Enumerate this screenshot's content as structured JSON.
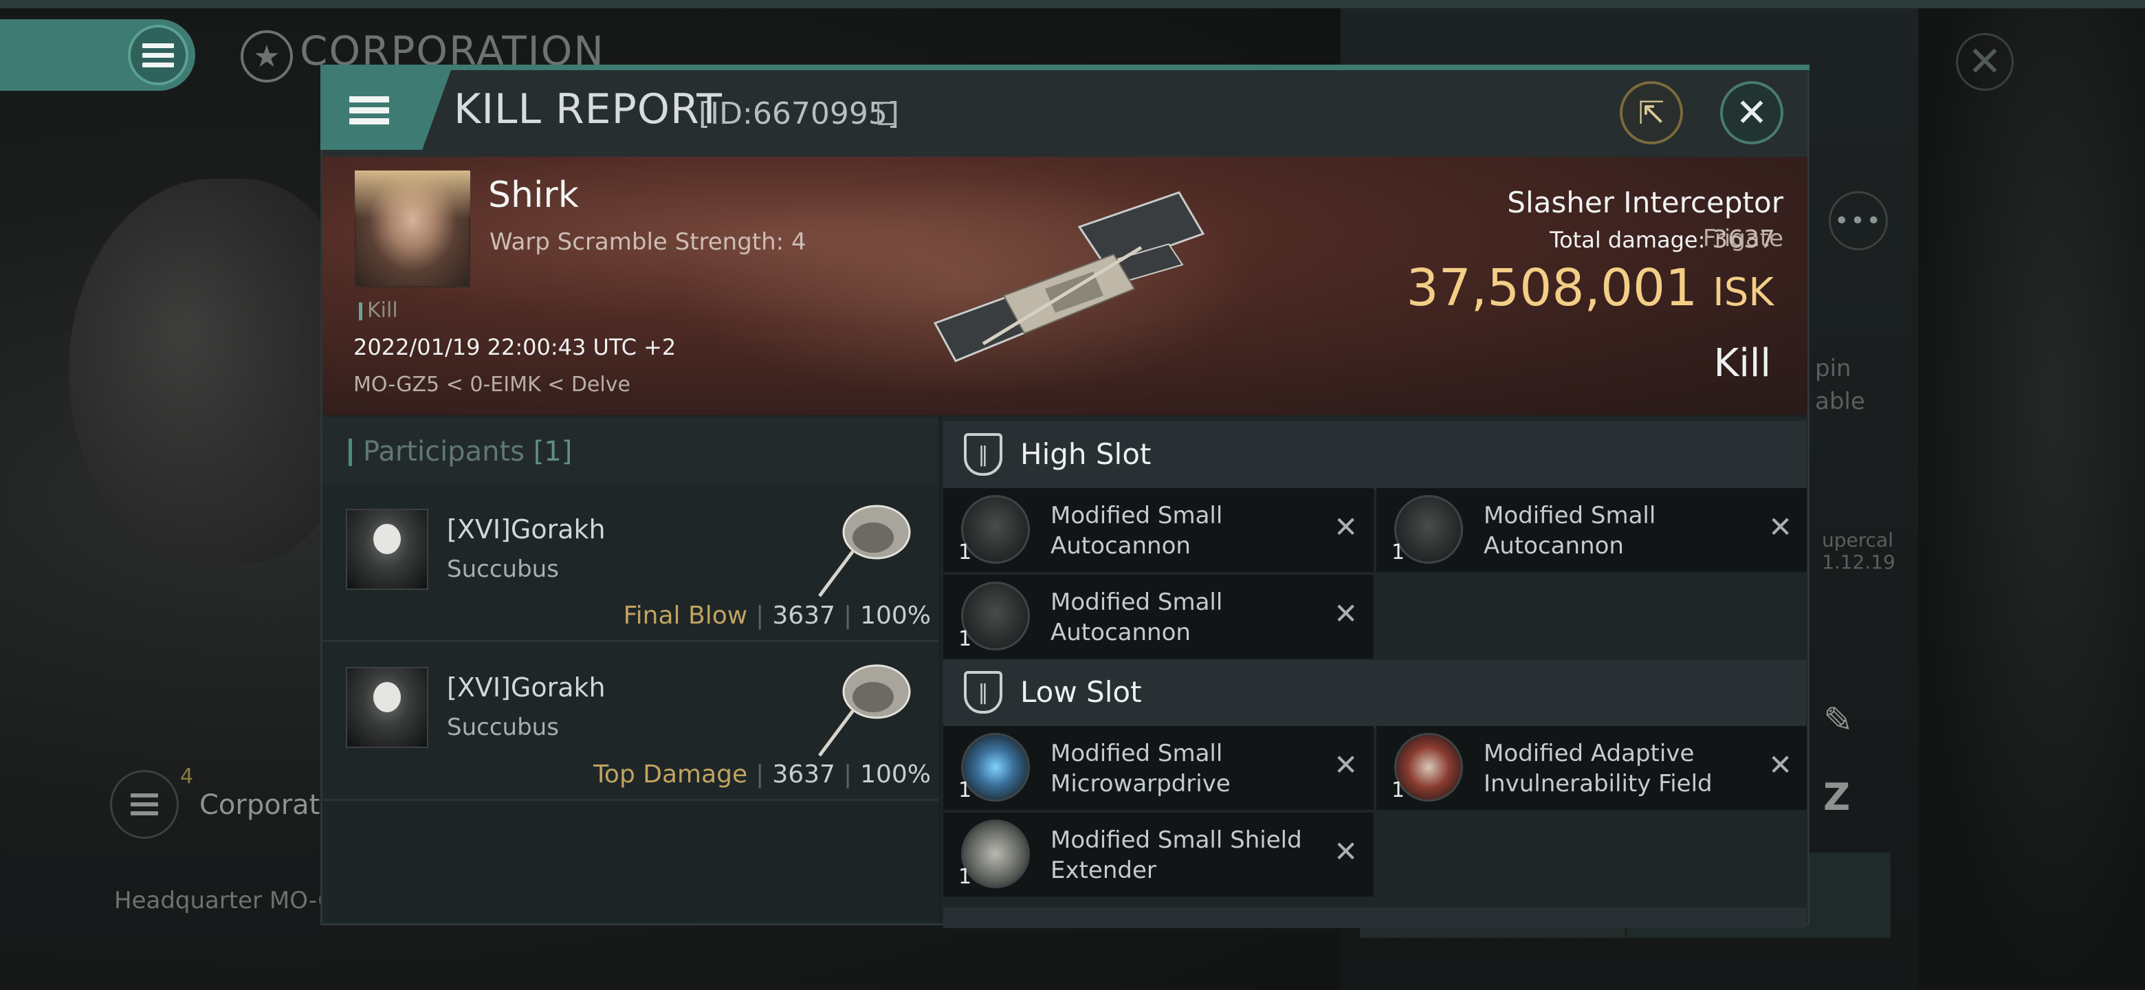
{
  "background": {
    "corp_title": "CORPORATION",
    "side_text_1": "pin",
    "side_text_2": "able",
    "side_text_3": "upercal",
    "side_text_4": "1.12.19",
    "corp_count": "4",
    "corp_label": "Corporati",
    "hq_label": "Headquarter MO-G"
  },
  "header": {
    "title": "KILL REPORT",
    "id": "[ID:6670995]"
  },
  "victim": {
    "name": "Shirk",
    "subtitle": "Warp Scramble Strength: 4",
    "kill_tag": "Kill",
    "datetime": "2022/01/19 22:00:43 UTC +2",
    "location": "MO-GZ5 < 0-EIMK < Delve",
    "ship_name": "Slasher Interceptor",
    "ship_class": "Frigate",
    "total_damage_label": "Total damage:",
    "total_damage": "3637",
    "isk_value": "37,508,001",
    "isk_unit": "ISK",
    "result": "Kill"
  },
  "participants": {
    "title": "Participants",
    "count": "[1]",
    "rows": [
      {
        "name": "[XVI]Gorakh",
        "ship": "Succubus",
        "role": "Final Blow",
        "damage": "3637",
        "percent": "100%"
      },
      {
        "name": "[XVI]Gorakh",
        "ship": "Succubus",
        "role": "Top Damage",
        "damage": "3637",
        "percent": "100%"
      }
    ]
  },
  "slots": {
    "high": {
      "title": "High Slot",
      "modules": [
        {
          "name": "Modified Small Autocannon",
          "qty": "1"
        },
        {
          "name": "Modified Small Autocannon",
          "qty": "1"
        },
        {
          "name": "Modified Small Autocannon",
          "qty": "1"
        }
      ]
    },
    "low": {
      "title": "Low Slot",
      "modules": [
        {
          "name": "Modified Small Microwarpdrive",
          "qty": "1"
        },
        {
          "name": "Modified Adaptive Invulnerability Field",
          "qty": "1"
        },
        {
          "name": "Modified Small Shield Extender",
          "qty": "1"
        }
      ]
    }
  },
  "colors": {
    "accent": "#3e7b73",
    "isk": "#f3ce86",
    "gold": "#c2a45f"
  }
}
